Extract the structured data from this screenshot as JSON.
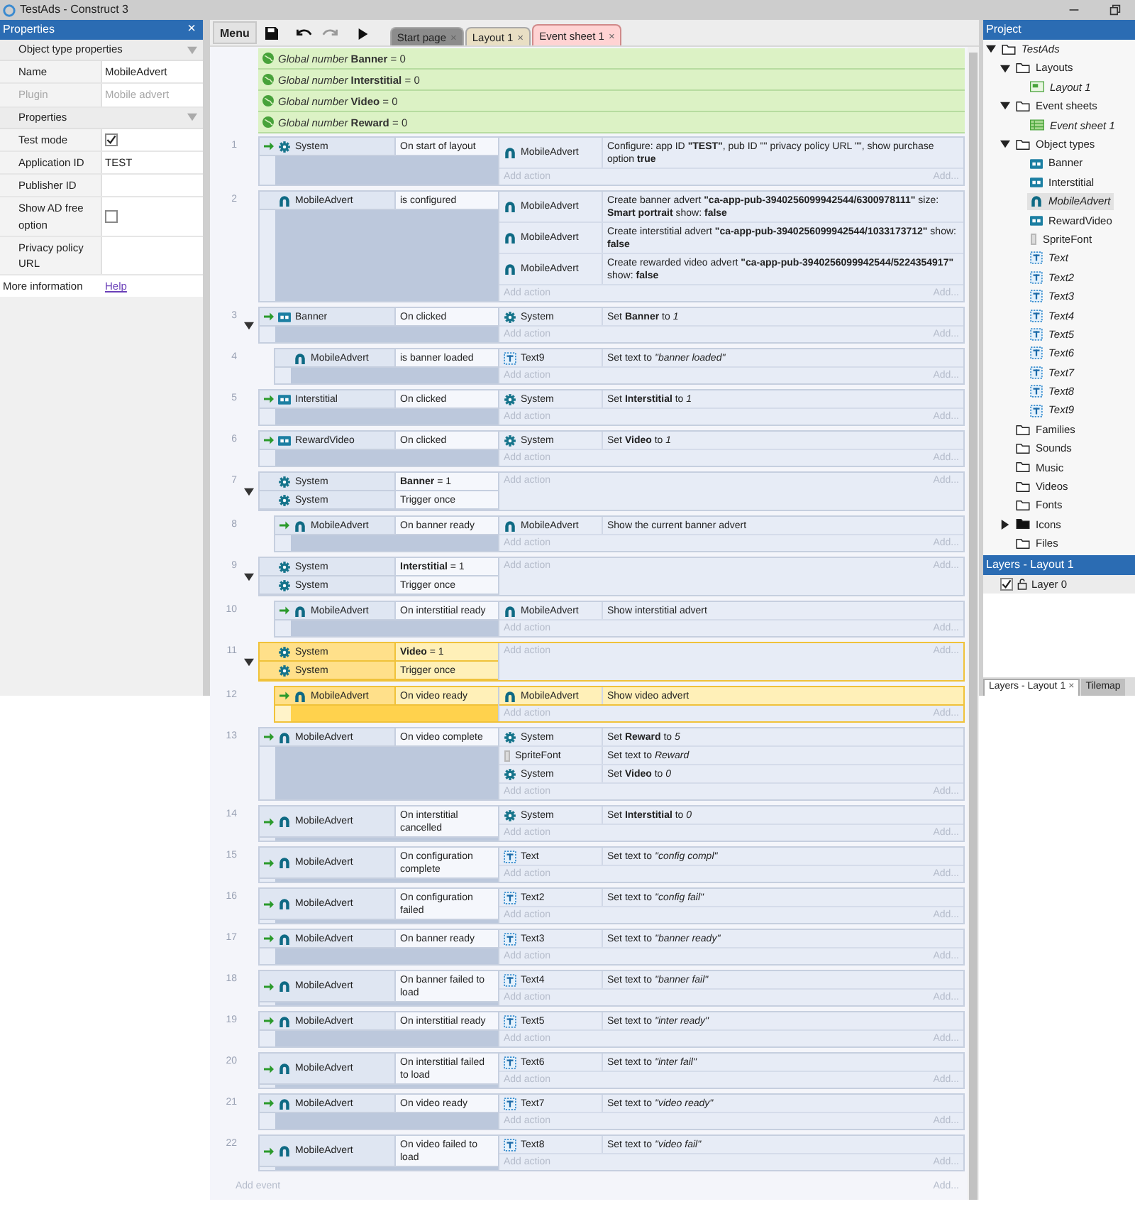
{
  "window": {
    "title": "TestAds - Construct 3"
  },
  "properties": {
    "title": "Properties",
    "close": "×",
    "sections": [
      {
        "title": "Object type properties",
        "expanded": true,
        "rows": [
          {
            "label": "Name",
            "kind": "text",
            "value": "MobileAdvert",
            "disabled": false
          },
          {
            "label": "Plugin",
            "kind": "text",
            "value": "Mobile advert",
            "disabled": true
          }
        ]
      },
      {
        "title": "Properties",
        "expanded": true,
        "rows": [
          {
            "label": "Test mode",
            "kind": "checkbox",
            "checked": true,
            "disabled": false
          },
          {
            "label": "Application ID",
            "kind": "text",
            "value": "TEST",
            "disabled": false
          },
          {
            "label": "Publisher ID",
            "kind": "text",
            "disabled": false
          },
          {
            "label": "Show AD free option",
            "kind": "checkbox",
            "checked": false,
            "disabled": false
          },
          {
            "label": "Privacy policy URL",
            "kind": "text",
            "disabled": false
          }
        ]
      }
    ],
    "more_info": {
      "label": "More information",
      "link": "Help"
    }
  },
  "toolbar": {
    "menu": "Menu"
  },
  "tabs": [
    {
      "label": "Start page",
      "close": "×",
      "color": "#8c8c8c",
      "selected": false
    },
    {
      "label": "Layout 1",
      "close": "×",
      "color": "#e9dfc4",
      "selected": false
    },
    {
      "label": "Event sheet 1",
      "close": "×",
      "color": "#ffd3d3",
      "selected": true
    }
  ],
  "globals": [
    {
      "text": "*Global number* **Banner** = 0"
    },
    {
      "text": "*Global number* **Interstitial** = 0"
    },
    {
      "text": "*Global number* **Video** = 0"
    },
    {
      "text": "*Global number* **Reward** = 0"
    }
  ],
  "events": [
    {
      "number": "1",
      "trigger": true,
      "selected": false,
      "conditions": [
        {
          "object": "System",
          "kind": "system",
          "text": "On start of layout"
        }
      ],
      "actions": [
        {
          "object": "MobileAdvert",
          "kind": "mobileadvert",
          "text": "Configure: app ID **\"TEST\"**, pub ID \"\" privacy policy URL \"\", show purchase option **true**"
        }
      ],
      "add_action": "Add action",
      "add_more": "Add..."
    },
    {
      "number": "2",
      "trigger": false,
      "selected": false,
      "conditions": [
        {
          "object": "MobileAdvert",
          "kind": "mobileadvert",
          "text": "is configured"
        }
      ],
      "actions": [
        {
          "object": "MobileAdvert",
          "kind": "mobileadvert",
          "text": "Create banner advert **\"ca-app-pub-3940256099942544/6300978111\"** size: **Smart portrait** show: **false**"
        },
        {
          "object": "MobileAdvert",
          "kind": "mobileadvert",
          "text": "Create interstitial advert **\"ca-app-pub-3940256099942544/1033173712\"** show: **false**"
        },
        {
          "object": "MobileAdvert",
          "kind": "mobileadvert",
          "text": "Create rewarded video advert **\"ca-app-pub-3940256099942544/5224354917\"** show: **false**"
        }
      ],
      "add_action": "Add action",
      "add_more": "Add..."
    },
    {
      "number": "3",
      "trigger": true,
      "selected": false,
      "expanded": true,
      "conditions": [
        {
          "object": "Banner",
          "kind": "button",
          "text": "On clicked"
        }
      ],
      "actions": [
        {
          "object": "System",
          "kind": "system",
          "text": "Set **Banner** to *1*"
        }
      ],
      "add_action": "Add action",
      "add_more": "Add...",
      "children": [
        {
          "number": "4",
          "trigger": false,
          "selected": false,
          "conditions": [
            {
              "object": "MobileAdvert",
              "kind": "mobileadvert",
              "text": "is banner loaded"
            }
          ],
          "actions": [
            {
              "object": "Text9",
              "kind": "text",
              "text": "Set text to *\"banner loaded\"*"
            }
          ],
          "add_action": "Add action",
          "add_more": "Add..."
        }
      ]
    },
    {
      "number": "5",
      "trigger": true,
      "selected": false,
      "conditions": [
        {
          "object": "Interstitial",
          "kind": "button",
          "text": "On clicked"
        }
      ],
      "actions": [
        {
          "object": "System",
          "kind": "system",
          "text": "Set **Interstitial** to *1*"
        }
      ],
      "add_action": "Add action",
      "add_more": "Add..."
    },
    {
      "number": "6",
      "trigger": true,
      "selected": false,
      "conditions": [
        {
          "object": "RewardVideo",
          "kind": "button",
          "text": "On clicked"
        }
      ],
      "actions": [
        {
          "object": "System",
          "kind": "system",
          "text": "Set **Video** to *1*"
        }
      ],
      "add_action": "Add action",
      "add_more": "Add..."
    },
    {
      "number": "7",
      "trigger": false,
      "selected": false,
      "expanded": true,
      "conditions": [
        {
          "object": "System",
          "kind": "system",
          "text": "**Banner** = 1"
        },
        {
          "object": "System",
          "kind": "system",
          "text": "Trigger once"
        }
      ],
      "add_action": "Add action",
      "add_more": "Add...",
      "children": [
        {
          "number": "8",
          "trigger": true,
          "selected": false,
          "conditions": [
            {
              "object": "MobileAdvert",
              "kind": "mobileadvert",
              "text": "On banner ready"
            }
          ],
          "actions": [
            {
              "object": "MobileAdvert",
              "kind": "mobileadvert",
              "text": "Show the current banner advert"
            }
          ],
          "add_action": "Add action",
          "add_more": "Add..."
        }
      ]
    },
    {
      "number": "9",
      "trigger": false,
      "selected": false,
      "expanded": true,
      "conditions": [
        {
          "object": "System",
          "kind": "system",
          "text": "**Interstitial** = 1"
        },
        {
          "object": "System",
          "kind": "system",
          "text": "Trigger once"
        }
      ],
      "add_action": "Add action",
      "add_more": "Add...",
      "children": [
        {
          "number": "10",
          "trigger": true,
          "selected": false,
          "conditions": [
            {
              "object": "MobileAdvert",
              "kind": "mobileadvert",
              "text": "On interstitial ready"
            }
          ],
          "actions": [
            {
              "object": "MobileAdvert",
              "kind": "mobileadvert",
              "text": "Show interstitial advert"
            }
          ],
          "add_action": "Add action",
          "add_more": "Add..."
        }
      ]
    },
    {
      "number": "11",
      "trigger": false,
      "selected": true,
      "expanded": true,
      "conditions": [
        {
          "object": "System",
          "kind": "system",
          "text": "**Video** = 1"
        },
        {
          "object": "System",
          "kind": "system",
          "text": "Trigger once"
        }
      ],
      "add_action": "Add action",
      "add_more": "Add...",
      "children": [
        {
          "number": "12",
          "trigger": true,
          "selected": true,
          "conditions": [
            {
              "object": "MobileAdvert",
              "kind": "mobileadvert",
              "text": "On video ready"
            }
          ],
          "actions": [
            {
              "object": "MobileAdvert",
              "kind": "mobileadvert",
              "text": "Show video advert"
            }
          ],
          "add_action": "Add action",
          "add_more": "Add..."
        }
      ]
    },
    {
      "number": "13",
      "trigger": true,
      "selected": false,
      "conditions": [
        {
          "object": "MobileAdvert",
          "kind": "mobileadvert",
          "text": "On video complete"
        }
      ],
      "actions": [
        {
          "object": "System",
          "kind": "system",
          "text": "Set **Reward** to *5*"
        },
        {
          "object": "SpriteFont",
          "kind": "spritefont",
          "text": "Set text to *Reward*"
        },
        {
          "object": "System",
          "kind": "system",
          "text": "Set **Video** to *0*"
        }
      ],
      "add_action": "Add action",
      "add_more": "Add..."
    },
    {
      "number": "14",
      "trigger": true,
      "selected": false,
      "conditions": [
        {
          "object": "MobileAdvert",
          "kind": "mobileadvert",
          "text": "On interstitial cancelled"
        }
      ],
      "actions": [
        {
          "object": "System",
          "kind": "system",
          "text": "Set **Interstitial** to *0*"
        }
      ],
      "add_action": "Add action",
      "add_more": "Add..."
    },
    {
      "number": "15",
      "trigger": true,
      "selected": false,
      "conditions": [
        {
          "object": "MobileAdvert",
          "kind": "mobileadvert",
          "text": "On configuration complete"
        }
      ],
      "actions": [
        {
          "object": "Text",
          "kind": "text",
          "text": "Set text to *\"config compl\"*"
        }
      ],
      "add_action": "Add action",
      "add_more": "Add..."
    },
    {
      "number": "16",
      "trigger": true,
      "selected": false,
      "conditions": [
        {
          "object": "MobileAdvert",
          "kind": "mobileadvert",
          "text": "On configuration failed"
        }
      ],
      "actions": [
        {
          "object": "Text2",
          "kind": "text",
          "text": "Set text to *\"config fail\"*"
        }
      ],
      "add_action": "Add action",
      "add_more": "Add..."
    },
    {
      "number": "17",
      "trigger": true,
      "selected": false,
      "conditions": [
        {
          "object": "MobileAdvert",
          "kind": "mobileadvert",
          "text": "On banner ready"
        }
      ],
      "actions": [
        {
          "object": "Text3",
          "kind": "text",
          "text": "Set text to *\"banner ready\"*"
        }
      ],
      "add_action": "Add action",
      "add_more": "Add..."
    },
    {
      "number": "18",
      "trigger": true,
      "selected": false,
      "conditions": [
        {
          "object": "MobileAdvert",
          "kind": "mobileadvert",
          "text": "On banner failed to load"
        }
      ],
      "actions": [
        {
          "object": "Text4",
          "kind": "text",
          "text": "Set text to *\"banner fail\"*"
        }
      ],
      "add_action": "Add action",
      "add_more": "Add..."
    },
    {
      "number": "19",
      "trigger": true,
      "selected": false,
      "conditions": [
        {
          "object": "MobileAdvert",
          "kind": "mobileadvert",
          "text": "On interstitial ready"
        }
      ],
      "actions": [
        {
          "object": "Text5",
          "kind": "text",
          "text": "Set text to *\"inter ready\"*"
        }
      ],
      "add_action": "Add action",
      "add_more": "Add..."
    },
    {
      "number": "20",
      "trigger": true,
      "selected": false,
      "conditions": [
        {
          "object": "MobileAdvert",
          "kind": "mobileadvert",
          "text": "On interstitial failed to load"
        }
      ],
      "actions": [
        {
          "object": "Text6",
          "kind": "text",
          "text": "Set text to *\"inter fail\"*"
        }
      ],
      "add_action": "Add action",
      "add_more": "Add..."
    },
    {
      "number": "21",
      "trigger": true,
      "selected": false,
      "conditions": [
        {
          "object": "MobileAdvert",
          "kind": "mobileadvert",
          "text": "On video ready"
        }
      ],
      "actions": [
        {
          "object": "Text7",
          "kind": "text",
          "text": "Set text to *\"video ready\"*"
        }
      ],
      "add_action": "Add action",
      "add_more": "Add..."
    },
    {
      "number": "22",
      "trigger": true,
      "selected": false,
      "conditions": [
        {
          "object": "MobileAdvert",
          "kind": "mobileadvert",
          "text": "On video failed to load"
        }
      ],
      "actions": [
        {
          "object": "Text8",
          "kind": "text",
          "text": "Set text to *\"video fail\"*"
        }
      ],
      "add_action": "Add action",
      "add_more": "Add..."
    }
  ],
  "add_event": {
    "label": "Add event",
    "more": "Add..."
  },
  "project": {
    "title": "Project",
    "tree": [
      {
        "label": "TestAds",
        "kind": "folder",
        "italic": true,
        "selected": false,
        "expanded": true,
        "children": [
          {
            "label": "Layouts",
            "kind": "folder",
            "italic": false,
            "selected": false,
            "expanded": true,
            "children": [
              {
                "label": "Layout 1",
                "kind": "layout",
                "italic": true,
                "selected": false
              }
            ]
          },
          {
            "label": "Event sheets",
            "kind": "folder",
            "italic": false,
            "selected": false,
            "expanded": true,
            "children": [
              {
                "label": "Event sheet 1",
                "kind": "eventsheet",
                "italic": true,
                "selected": false
              }
            ]
          },
          {
            "label": "Object types",
            "kind": "folder",
            "italic": false,
            "selected": false,
            "expanded": true,
            "children": [
              {
                "label": "Banner",
                "kind": "button",
                "italic": false,
                "selected": false
              },
              {
                "label": "Interstitial",
                "kind": "button",
                "italic": false,
                "selected": false
              },
              {
                "label": "MobileAdvert",
                "kind": "mobileadvert",
                "italic": true,
                "selected": true
              },
              {
                "label": "RewardVideo",
                "kind": "button",
                "italic": false,
                "selected": false
              },
              {
                "label": "SpriteFont",
                "kind": "spritefont",
                "italic": false,
                "selected": false
              },
              {
                "label": "Text",
                "kind": "text",
                "italic": true,
                "selected": false
              },
              {
                "label": "Text2",
                "kind": "text",
                "italic": true,
                "selected": false
              },
              {
                "label": "Text3",
                "kind": "text",
                "italic": true,
                "selected": false
              },
              {
                "label": "Text4",
                "kind": "text",
                "italic": true,
                "selected": false
              },
              {
                "label": "Text5",
                "kind": "text",
                "italic": true,
                "selected": false
              },
              {
                "label": "Text6",
                "kind": "text",
                "italic": true,
                "selected": false
              },
              {
                "label": "Text7",
                "kind": "text",
                "italic": true,
                "selected": false
              },
              {
                "label": "Text8",
                "kind": "text",
                "italic": true,
                "selected": false
              },
              {
                "label": "Text9",
                "kind": "text",
                "italic": true,
                "selected": false
              }
            ]
          },
          {
            "label": "Families",
            "kind": "folder",
            "italic": false,
            "selected": false
          },
          {
            "label": "Sounds",
            "kind": "folder",
            "italic": false,
            "selected": false
          },
          {
            "label": "Music",
            "kind": "folder",
            "italic": false,
            "selected": false
          },
          {
            "label": "Videos",
            "kind": "folder",
            "italic": false,
            "selected": false
          },
          {
            "label": "Fonts",
            "kind": "folder",
            "italic": false,
            "selected": false
          },
          {
            "label": "Icons",
            "kind": "folder-filled",
            "italic": false,
            "selected": false,
            "expanded": false
          },
          {
            "label": "Files",
            "kind": "folder",
            "italic": false,
            "selected": false
          }
        ]
      }
    ]
  },
  "layers": {
    "title": "Layers - Layout 1",
    "items": [
      {
        "label": "Layer 0",
        "visible": true,
        "locked": false
      }
    ]
  },
  "bottom_tabs": [
    {
      "label": "Layers - Layout 1",
      "close": "×",
      "selected": true
    },
    {
      "label": "Tilemap",
      "selected": false
    }
  ]
}
